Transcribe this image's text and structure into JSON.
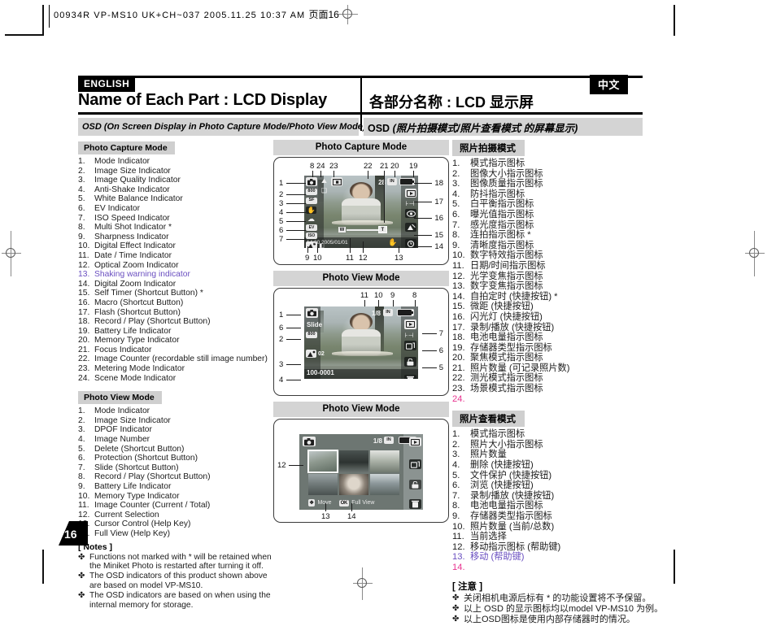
{
  "slug": {
    "line": "00934R VP-MS10 UK+CH~037   2005.11.25 10:37 AM",
    "cjk": "页面16"
  },
  "header": {
    "lang_en": "ENGLISH",
    "lang_cn": "中文",
    "title_en": "Name of Each Part : LCD Display",
    "title_cn": "各部分名称 : LCD 显示屏",
    "subtitle_en": "OSD (On Screen Display in Photo Capture Mode/Photo View Mode)",
    "subtitle_cn_prefix": "OSD ",
    "subtitle_cn_italic": "(照片拍摄模式/照片查看模式 的屏幕显示)"
  },
  "page_number": "16",
  "left": {
    "capture_heading": "Photo Capture Mode",
    "capture_items": [
      "Mode Indicator",
      "Image Size Indicator",
      "Image Quality Indicator",
      "Anti-Shake Indicator",
      "White Balance Indicator",
      "EV Indicator",
      "ISO Speed Indicator",
      "Multi Shot Indicator *",
      "Sharpness Indicator",
      "Digital Effect Indicator",
      "Date / Time Indicator",
      "Optical Zoom Indicator",
      "Shaking warning indicator",
      "Digital Zoom Indicator",
      "Self Timer (Shortcut Button) *",
      "Macro (Shortcut Button)",
      "Flash (Shortcut Button)",
      "Record / Play (Shortcut Button)",
      "Battery Life Indicator",
      "Memory Type Indicator",
      "Focus Indicator",
      "Image Counter (recordable still image number)",
      "Metering Mode Indicator",
      "Scene Mode Indicator"
    ],
    "capture_highlight_index": 12,
    "view_heading": "Photo View Mode",
    "view_items": [
      "Mode Indicator",
      "Image Size Indicator",
      "DPOF Indicator",
      "Image Number",
      "Delete (Shortcut Button)",
      "Protection (Shortcut Button)",
      "Slide (Shortcut Button)",
      "Record / Play (Shortcut Button)",
      "Battery Life Indicator",
      "Memory Type Indicator",
      "Image Counter (Current / Total)",
      "Current Selection",
      "Cursor Control (Help Key)",
      "Full View (Help Key)"
    ],
    "notes_heading": "[ Notes ]",
    "notes": [
      "Functions not marked with * will be retained when the Miniket Photo is restarted after turning it off.",
      "The OSD indicators of this product shown above are based on model VP-MS10.",
      "The OSD indicators are based on when using the internal memory for storage."
    ]
  },
  "right": {
    "capture_heading": "照片拍摄模式",
    "capture_items": [
      "模式指示图标",
      "图像大小指示图标",
      "图像质量指示图标",
      "防抖指示图标",
      "白平衡指示图标",
      "曝光值指示图标",
      "感光度指示图标",
      "连拍指示图标 *",
      "清晰度指示图标",
      "数字特效指示图标",
      "日期/时间指示图标",
      "光学变焦指示图标",
      "数字变焦指示图标",
      "自拍定时 (快捷按钮) *",
      "微距 (快捷按钮)",
      "闪光灯 (快捷按钮)",
      "录制/播放 (快捷按钮)",
      "电池电量指示图标",
      "存储器类型指示图标",
      "聚焦模式指示图标",
      "照片数量 (可记录照片数)",
      "测光模式指示图标",
      "场景模式指示图标",
      ""
    ],
    "capture_pink_index": 23,
    "view_heading": "照片查看模式",
    "view_items": [
      "模式指示图标",
      "照片大小指示图标",
      "照片数量",
      "删除 (快捷按钮)",
      "文件保护 (快捷按钮)",
      "浏览 (快捷按钮)",
      "录制/播放 (快捷按钮)",
      "电池电量指示图标",
      "存储器类型指示图标",
      "照片数量 (当前/总数)",
      "当前选择",
      "移动指示图标 (帮助键)",
      "移动 (帮助键)",
      ""
    ],
    "view_highlight_index": 12,
    "view_pink_index": 13,
    "notes_heading": "[ 注意 ]",
    "notes": [
      "关闭相机电源后标有 * 的功能设置将不予保留。",
      "以上 OSD 的显示图标均以model VP-MS10 为例。",
      "以上OSD图标是使用内部存储器时的情况。"
    ]
  },
  "panels": [
    {
      "caption": "Photo Capture Mode",
      "mode": "capture",
      "osd": {
        "mode_icon": "camera-icon",
        "image_size": "800",
        "image_quality": "SF",
        "anti_shake": "hand-icon",
        "white_balance": "cloud-icon",
        "ev": "EV",
        "iso": "ISO",
        "multi_shot": "burst-icon",
        "scene": "scene-icon",
        "metering": "metering-icon",
        "image_counter": "28",
        "memory_type": "IN",
        "battery": "battery-icon",
        "record_play": "play-icon",
        "flash": "flash-icon",
        "macro": "macro-icon",
        "self_timer": "timer-icon",
        "zoom_wide": "W",
        "zoom_tele": "T",
        "datetime": "14:00 2005/01/01",
        "shake_warning": "shake-icon"
      },
      "callouts_left": [
        "1",
        "2",
        "3",
        "4",
        "5",
        "6",
        "7"
      ],
      "callouts_right": [
        "18",
        "17",
        "16",
        "15",
        "14"
      ],
      "callouts_top": [
        "8",
        "24",
        "23",
        "22",
        "21",
        "20",
        "19"
      ],
      "callouts_bottom": [
        "9",
        "10",
        "11",
        "12",
        "13"
      ]
    },
    {
      "caption": "Photo View Mode",
      "mode": "view-single",
      "osd": {
        "mode_icon": "camera-icon",
        "slide_label": "Slide",
        "image_size": "800",
        "dpof": "DPOF",
        "dpof_count": "02",
        "image_number": "100-0001",
        "image_counter": "1/8",
        "memory_type": "IN",
        "battery": "battery-icon",
        "record_play": "play-icon",
        "slide_icon": "slide-icon",
        "protect": "protect-icon",
        "delete": "trash-icon"
      },
      "callouts_left": [
        "1",
        "6",
        "2",
        "3",
        "4"
      ],
      "callouts_right": [
        "8",
        "7",
        "6",
        "5"
      ],
      "callouts_top": [
        "11",
        "10",
        "9",
        "8"
      ]
    },
    {
      "caption": "Photo View Mode",
      "mode": "view-multi",
      "osd": {
        "mode_icon": "camera-icon",
        "image_counter": "1/8",
        "memory_type": "IN",
        "battery": "battery-icon",
        "record_play": "play-icon",
        "slide_icon": "slide-icon",
        "protect": "lock-icon",
        "delete": "trash-icon",
        "help_move": "Move",
        "help_move_key": "cursor-key-icon",
        "help_full": "Full View",
        "help_full_key": "OK"
      },
      "callouts_left": [
        "12"
      ],
      "callouts_bottom": [
        "13",
        "14"
      ]
    }
  ]
}
